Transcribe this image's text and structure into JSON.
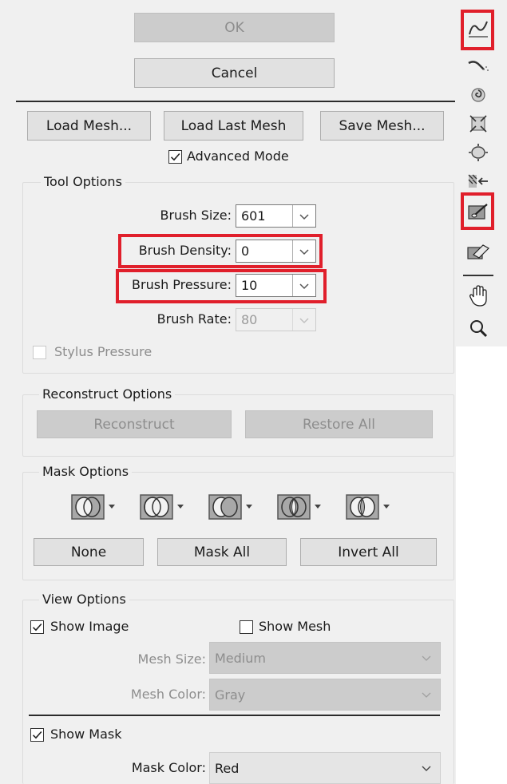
{
  "buttons": {
    "ok": "OK",
    "cancel": "Cancel",
    "load_mesh": "Load Mesh...",
    "load_last_mesh": "Load Last Mesh",
    "save_mesh": "Save Mesh..."
  },
  "advanced_mode": {
    "label": "Advanced Mode",
    "checked": true
  },
  "tool_options": {
    "legend": "Tool Options",
    "brush_size": {
      "label": "Brush Size:",
      "value": "601"
    },
    "brush_density": {
      "label": "Brush Density:",
      "value": "0"
    },
    "brush_pressure": {
      "label": "Brush Pressure:",
      "value": "10"
    },
    "brush_rate": {
      "label": "Brush Rate:",
      "value": "80"
    },
    "stylus_pressure": {
      "label": "Stylus Pressure",
      "checked": false
    }
  },
  "reconstruct_options": {
    "legend": "Reconstruct Options",
    "reconstruct": "Reconstruct",
    "restore_all": "Restore All"
  },
  "mask_options": {
    "legend": "Mask Options",
    "none": "None",
    "mask_all": "Mask All",
    "invert_all": "Invert All"
  },
  "view_options": {
    "legend": "View Options",
    "show_image": {
      "label": "Show Image",
      "checked": true
    },
    "show_mesh": {
      "label": "Show Mesh",
      "checked": false
    },
    "mesh_size": {
      "label": "Mesh Size:",
      "value": "Medium"
    },
    "mesh_color": {
      "label": "Mesh Color:",
      "value": "Gray"
    },
    "show_mask": {
      "label": "Show Mask",
      "checked": true
    },
    "mask_color": {
      "label": "Mask Color:",
      "value": "Red"
    }
  },
  "toolbar": {
    "tools": [
      "forward-warp-tool-icon",
      "reconstruct-tool-icon",
      "twirl-clockwise-tool-icon",
      "pucker-tool-icon",
      "bloat-tool-icon",
      "push-left-tool-icon",
      "freeze-mask-tool-icon",
      "thaw-mask-tool-icon",
      "hand-tool-icon",
      "zoom-tool-icon"
    ]
  },
  "colors": {
    "highlight": "#e01f2b",
    "panel_bg": "#f0f0f0",
    "button_bg": "#e1e1e1",
    "disabled_text": "#8d8d8d"
  }
}
